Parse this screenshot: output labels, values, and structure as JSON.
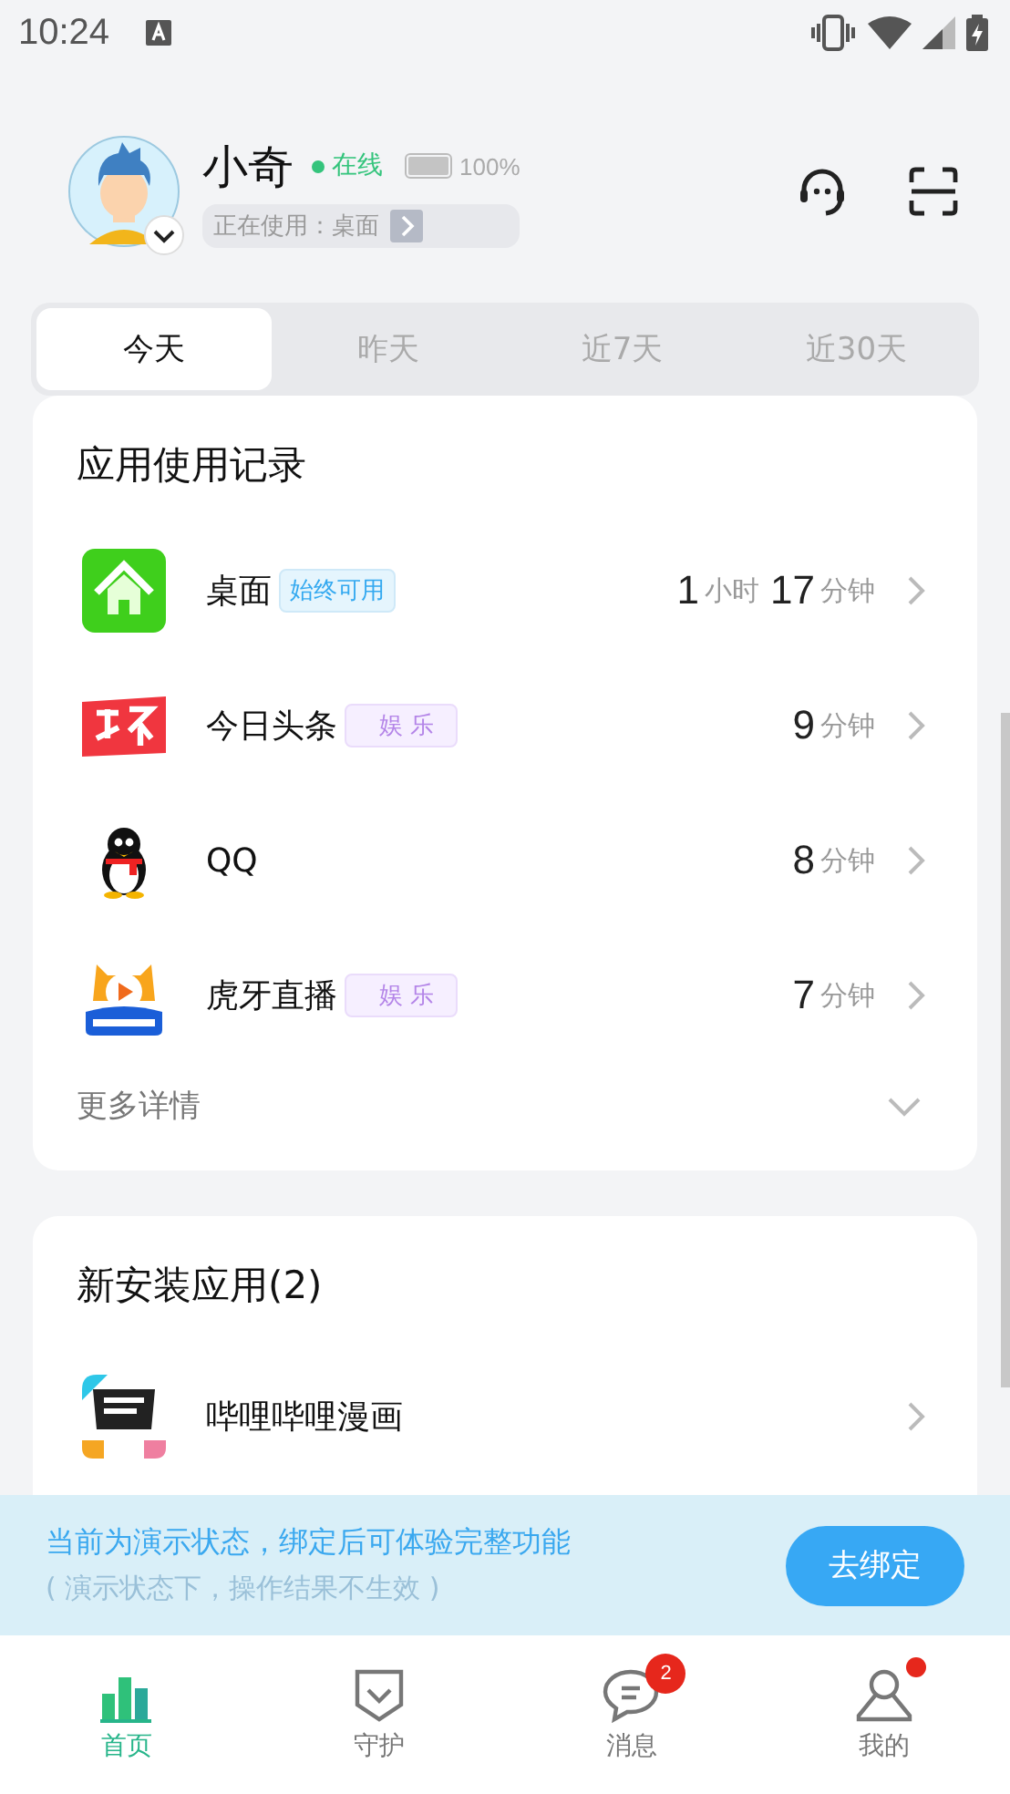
{
  "status_bar": {
    "time": "10:24"
  },
  "profile": {
    "name": "小奇",
    "online": true,
    "online_label": "在线",
    "battery": {
      "level": 1.0,
      "reading": "100%"
    },
    "current_use": {
      "label": "正在使用：桌面"
    }
  },
  "tabs": [
    {
      "label": "今天",
      "selected": true
    },
    {
      "label": "昨天",
      "selected": false
    },
    {
      "label": "近7天",
      "selected": false
    },
    {
      "label": "近30天",
      "selected": false
    }
  ],
  "usage_card": {
    "title": "应用使用记录",
    "apps": [
      {
        "name": "桌面",
        "tag": {
          "kind": "always",
          "label": "始终可用"
        },
        "duration": [
          {
            "value": "1",
            "unit": "小时"
          },
          {
            "value": "17",
            "unit": "分钟"
          }
        ]
      },
      {
        "name": "今日头条",
        "tag": {
          "kind": "category",
          "label": "娱 乐"
        },
        "duration": [
          {
            "value": "9",
            "unit": "分钟"
          }
        ]
      },
      {
        "name": "QQ",
        "duration": [
          {
            "value": "8",
            "unit": "分钟"
          }
        ]
      },
      {
        "name": "虎牙直播",
        "tag": {
          "kind": "category",
          "label": "娱 乐"
        },
        "duration": [
          {
            "value": "7",
            "unit": "分钟"
          }
        ]
      }
    ],
    "more": "更多详情"
  },
  "install_card": {
    "title": "新安装应用(2)",
    "apps": [
      {
        "name": "哔哩哔哩漫画"
      }
    ]
  },
  "demo_banner": {
    "line1": "当前为演示状态，绑定后可体验完整功能",
    "line2": "( 演示状态下，操作结果不生效 )",
    "button": "去绑定"
  },
  "nav": [
    {
      "label": "首页",
      "selected": true
    },
    {
      "label": "守护",
      "selected": false
    },
    {
      "label": "消息",
      "selected": false,
      "badge": "2"
    },
    {
      "label": "我的",
      "selected": false,
      "dot": true
    }
  ]
}
